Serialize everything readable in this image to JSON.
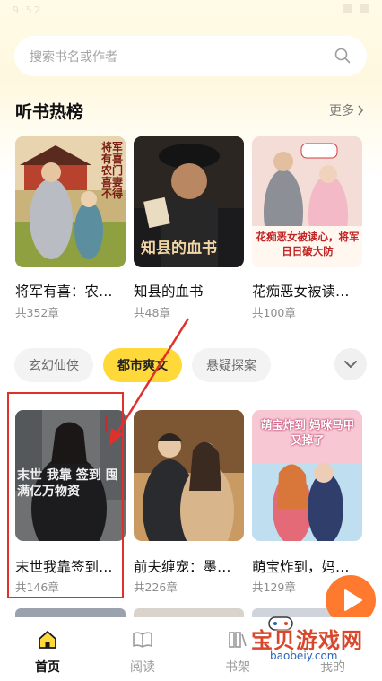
{
  "status_bar": {
    "time": "9:52"
  },
  "search": {
    "placeholder": "搜索书名或作者"
  },
  "hot_section": {
    "title": "听书热榜",
    "more_label": "更多"
  },
  "hot_books": [
    {
      "title": "将军有喜：农…",
      "chapters": "共352章",
      "cover_text": "将军有喜 农门喜妻不得"
    },
    {
      "title": "知县的血书",
      "chapters": "共48章",
      "cover_text": "知县的血书"
    },
    {
      "title": "花痴恶女被读…",
      "chapters": "共100章",
      "cover_text": "花痴恶女被读心，将军日日破大防"
    }
  ],
  "category_tabs": [
    {
      "label": "玄幻仙侠",
      "selected": false
    },
    {
      "label": "都市爽文",
      "selected": true
    },
    {
      "label": "悬疑探案",
      "selected": false
    }
  ],
  "category_books": [
    {
      "title": "末世我靠签到…",
      "chapters": "共146章",
      "cover_text": "末世 我靠 签到 囤满亿万物资"
    },
    {
      "title": "前夫缠宠：墨…",
      "chapters": "共226章",
      "cover_text": ""
    },
    {
      "title": "萌宝炸到，妈…",
      "chapters": "共129章",
      "cover_text": "萌宝炸到 妈咪马甲又掉了"
    }
  ],
  "tab_bar": [
    {
      "label": "首页",
      "icon": "home-icon",
      "active": true
    },
    {
      "label": "阅读",
      "icon": "book-open-icon",
      "active": false
    },
    {
      "label": "书架",
      "icon": "bookshelf-icon",
      "active": false
    },
    {
      "label": "我的",
      "icon": "profile-icon",
      "active": false
    }
  ],
  "watermark": {
    "text": "宝贝游戏网",
    "url": "baobeiy.com"
  },
  "colors": {
    "accent": "#ffd83a",
    "annotation": "#e0302c",
    "fab": "#ff7a2e"
  }
}
